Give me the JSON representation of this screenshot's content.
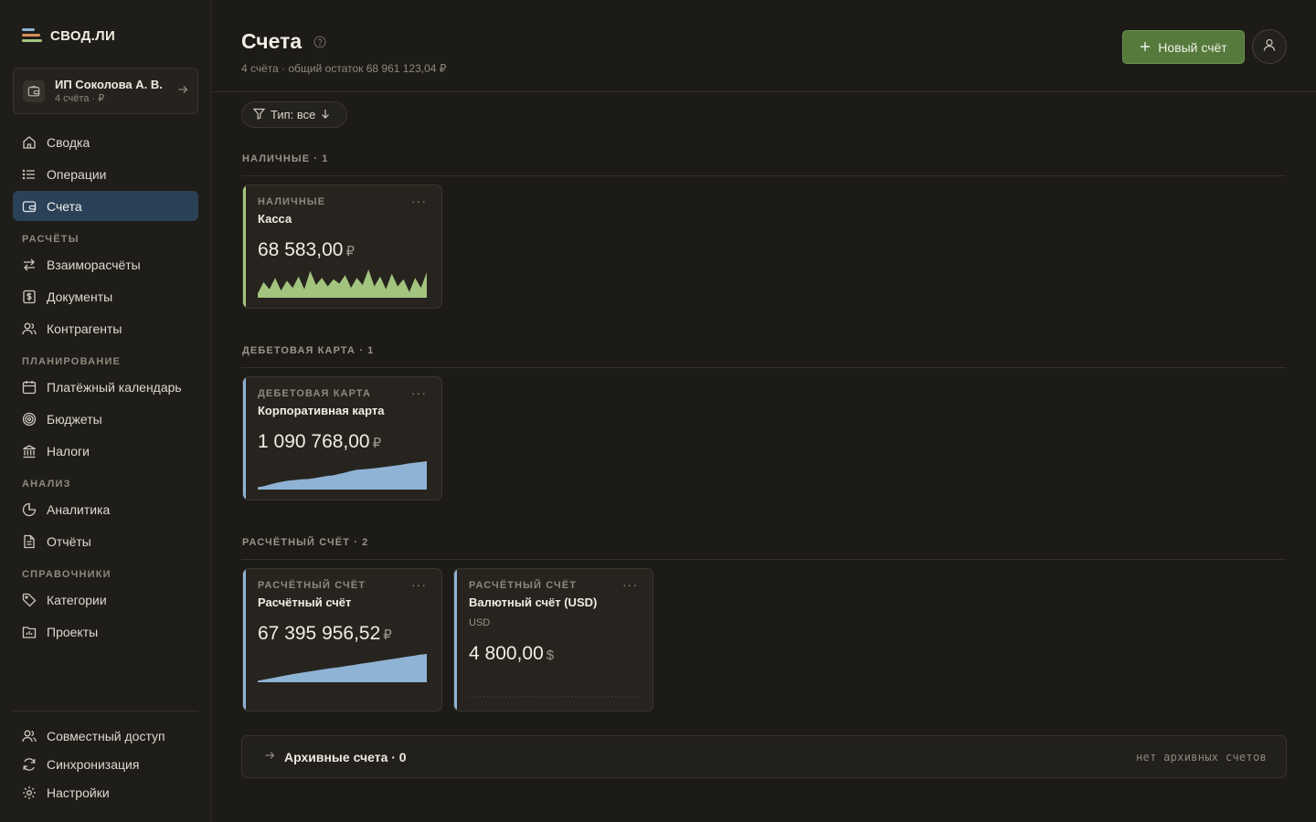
{
  "app": {
    "logo_text": "СВОД.ЛИ"
  },
  "org": {
    "name": "ИП Соколова А. В.",
    "sub": "4 счёта · ₽"
  },
  "nav": {
    "main": [
      {
        "label": "Сводка",
        "icon": "home-icon"
      },
      {
        "label": "Операции",
        "icon": "list-icon"
      },
      {
        "label": "Счета",
        "icon": "wallet-icon",
        "active": true
      }
    ],
    "sections": [
      {
        "title": "РАСЧЁТЫ",
        "items": [
          "Взаиморасчёты",
          "Документы",
          "Контрагенты"
        ]
      },
      {
        "title": "ПЛАНИРОВАНИЕ",
        "items": [
          "Платёжный календарь",
          "Бюджеты",
          "Налоги"
        ]
      },
      {
        "title": "АНАЛИЗ",
        "items": [
          "Аналитика",
          "Отчёты"
        ]
      },
      {
        "title": "СПРАВОЧНИКИ",
        "items": [
          "Категории",
          "Проекты"
        ]
      }
    ],
    "bottom": [
      "Совместный доступ",
      "Синхронизация",
      "Настройки"
    ]
  },
  "header": {
    "title": "Счета",
    "subtitle": "4 счёта · общий остаток 68 961 123,04 ₽",
    "new_button": "Новый счёт"
  },
  "filter": {
    "label": "Тип: все"
  },
  "groups": [
    {
      "label": "НАЛИЧНЫЕ · 1"
    },
    {
      "label": "ДЕБЕТОВАЯ КАРТА · 1"
    },
    {
      "label": "РАСЧЁТНЫЙ СЧЁТ · 2"
    }
  ],
  "accounts": [
    {
      "kind": "НАЛИЧНЫЕ",
      "name": "Касса",
      "amount": "68 583,00",
      "currency": "₽",
      "color": "#a3c47e",
      "series": [
        0.15,
        0.55,
        0.3,
        0.7,
        0.25,
        0.6,
        0.35,
        0.75,
        0.3,
        0.95,
        0.45,
        0.7,
        0.4,
        0.65,
        0.5,
        0.8,
        0.35,
        0.7,
        0.45,
        1.0,
        0.4,
        0.75,
        0.3,
        0.85,
        0.4,
        0.65,
        0.2,
        0.7,
        0.35,
        0.9
      ]
    },
    {
      "kind": "ДЕБЕТОВАЯ КАРТА",
      "name": "Корпоративная карта",
      "amount": "1 090 768,00",
      "currency": "₽",
      "color": "#8fb3d4",
      "series": [
        0.08,
        0.12,
        0.18,
        0.24,
        0.28,
        0.32,
        0.34,
        0.36,
        0.37,
        0.4,
        0.44,
        0.48,
        0.5,
        0.55,
        0.6,
        0.66,
        0.7,
        0.72,
        0.74,
        0.76,
        0.79,
        0.82,
        0.85,
        0.88,
        0.92,
        0.95,
        0.97,
        1.0
      ]
    },
    {
      "kind": "РАСЧЁТНЫЙ СЧЁТ",
      "name": "Расчётный счёт",
      "amount": "67 395 956,52",
      "currency": "₽",
      "color": "#8fb3d4",
      "series": [
        0.05,
        0.1,
        0.15,
        0.2,
        0.25,
        0.3,
        0.34,
        0.38,
        0.42,
        0.46,
        0.5,
        0.53,
        0.57,
        0.61,
        0.65,
        0.69,
        0.73,
        0.77,
        0.81,
        0.85,
        0.89,
        0.93,
        0.97,
        1.0
      ]
    },
    {
      "kind": "РАСЧЁТНЫЙ СЧЁТ",
      "name": "Валютный счёт (USD)",
      "currency_code": "USD",
      "amount": "4 800,00",
      "currency": "$",
      "color": "#8fb3d4"
    }
  ],
  "archive": {
    "title": "Архивные счета · 0",
    "note": "нет архивных счетов"
  }
}
